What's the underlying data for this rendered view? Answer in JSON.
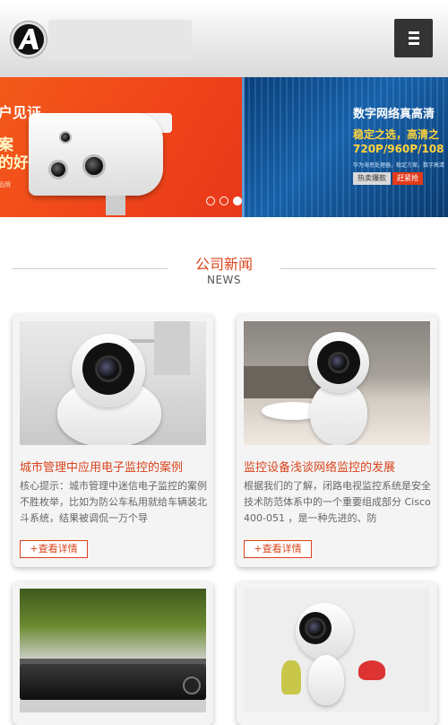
{
  "header": {
    "logo_letter": "A",
    "menu_icon": "hamburger-icon"
  },
  "banner": {
    "slide_left": {
      "line1": "户见证",
      "line2": "案",
      "line3": "的好",
      "tiny": "品牌"
    },
    "slide_right": {
      "headline": "数字网络真高清",
      "line2": "稳定之选，高清之",
      "line3": "720P/960P/108",
      "small": "华为海思处理器，稳定方案，数字高清",
      "btn_hot": "热卖爆款",
      "btn_buy": "赶紧抢"
    },
    "dots": 3,
    "active_dot": 3
  },
  "section": {
    "title": "公司新闻",
    "subtitle": "NEWS"
  },
  "cards": [
    {
      "title": "城市管理中应用电子监控的案例",
      "desc": "核心提示：城市管理中迷信电子监控的案例不胜枚举，比如为防公车私用就给车辆装北斗系统，结果被调侃一万个导",
      "more": "+查看详情"
    },
    {
      "title": "监控设备浅谈网络监控的发展",
      "desc": "根据我们的了解，闭路电视监控系统是安全技术防范体系中的一个重要组成部分 Cisco 400-051 ，是一种先进的、防",
      "more": "+查看详情"
    },
    {
      "title": "",
      "desc": "",
      "more": ""
    },
    {
      "title": "",
      "desc": "",
      "more": ""
    }
  ],
  "colors": {
    "accent": "#d9441c",
    "menu_bg": "#333333"
  }
}
